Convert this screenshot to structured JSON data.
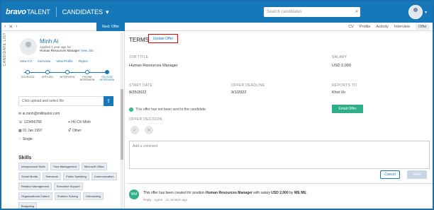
{
  "header": {
    "logo": "bravo",
    "logo_suffix": "TALENT",
    "section": "CANDIDATES",
    "search_placeholder": "Search candidates"
  },
  "subbar": {
    "next_offer": "Next: Offer",
    "tabs": [
      "CV",
      "Profile",
      "Activity",
      "Interview",
      "Offer"
    ]
  },
  "candidate": {
    "side_label": "CANDIDATE LIST",
    "name": "Minh Ai",
    "applied": "Applied 1 year ago for",
    "job": "Human Resources Manager",
    "view_job": "View Job",
    "actions": [
      "View CV",
      "Interview",
      "View Profile",
      "Reject"
    ],
    "stages": [
      "SOURCED",
      "APPLIED",
      "INTERVIEW",
      "PHONE INTERVIEW",
      "ON-SITE INTERVIEW"
    ],
    "upload": "Click upload and select file",
    "email": "ai.minh@millitaxtor.com",
    "phone": "123456789",
    "city": "Hồ Chí Minh",
    "dob": "01 Jan 1997",
    "gender": "Other",
    "status": "Single"
  },
  "skills": {
    "title": "Skills",
    "items": [
      "Interpersonal Skills",
      "Time Management",
      "Microsoft Office",
      "Social Media",
      "Teamwork",
      "Public Speaking",
      "Communication",
      "Relation Management",
      "Executive Support",
      "Organizational Culture",
      "Problem Solving",
      "Onboarding",
      "Budgeting"
    ]
  },
  "terms": {
    "title": "TERMS",
    "update": "Update Offer",
    "job_title_label": "JOB TITLE",
    "job_title": "Human Resources Manager",
    "salary_label": "SALARY",
    "salary": "USD 2,000",
    "start_label": "START DATE",
    "start": "8/25/2022",
    "deadline_label": "OFFER DEADLINE",
    "deadline": "9/1/2022",
    "reports_label": "REPORTS TO",
    "reports": "Khoi Vo",
    "notice": "This offer has not been sent to the candidate.",
    "email_btn": "Email Offer",
    "decision_label": "OFFER DECISION"
  },
  "comment": {
    "placeholder": "Add a comment",
    "cancel": "Cancel",
    "save": "Save"
  },
  "activity": {
    "initials": "WM",
    "text_pre": "This offer has been created for position ",
    "position": "Human Resources Manager",
    "text_mid": " with salary ",
    "salary": "USD 2,000",
    "text_post": " by ",
    "user": "WE ME",
    "meta": "Reply · Agree · 21 minutes ago"
  }
}
